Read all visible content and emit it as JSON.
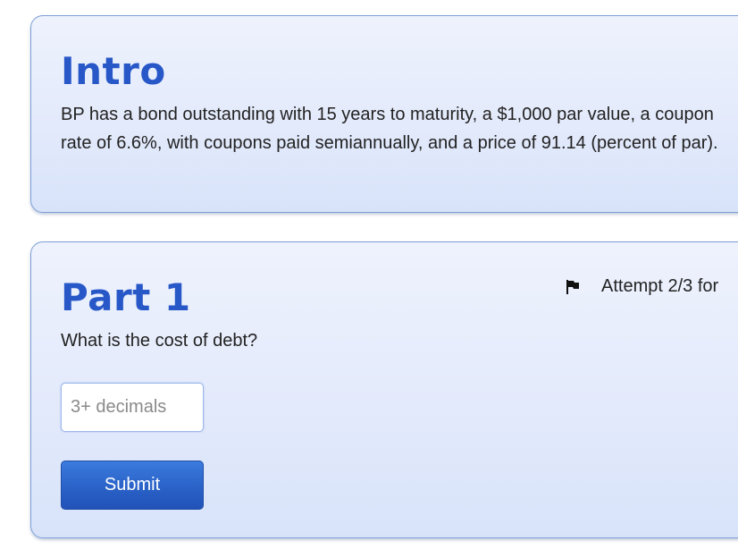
{
  "intro": {
    "heading": "Intro",
    "text": "BP has a bond outstanding with 15 years to maturity, a $1,000 par value, a coupon rate of 6.6%, with coupons paid semiannually, and a price of 91.14 (percent of par)."
  },
  "part1": {
    "heading": "Part 1",
    "question": "What is the cost of debt?",
    "attempt_text": "Attempt 2/3 for",
    "attempt_icon": "flag-icon",
    "answer_input": {
      "value": "",
      "placeholder": "3+ decimals"
    },
    "submit_label": "Submit"
  },
  "colors": {
    "heading": "#2858c8",
    "card_border": "#7ea0d6",
    "button": "#2a62c8"
  }
}
